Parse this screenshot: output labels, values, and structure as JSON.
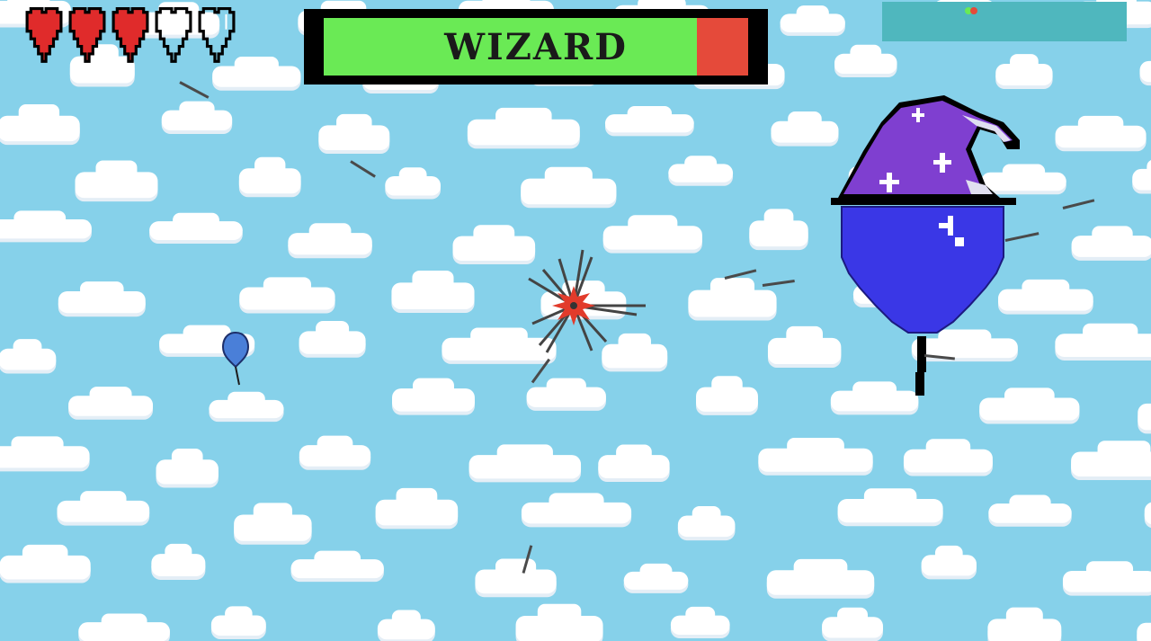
{
  "hud": {
    "hearts_total": 5,
    "hearts_filled": 3,
    "heart_color": "#e02b2b",
    "heart_icon": "pixel-heart-icon"
  },
  "boss": {
    "name": "WIZARD",
    "health_fraction": 0.88,
    "health_color": "#6aea55",
    "damage_color": "#e54a3a"
  },
  "minimap": {
    "background": "#4fb7be",
    "markers": [
      {
        "color": "#6aea55"
      },
      {
        "color": "#e54a3a"
      }
    ]
  },
  "colors": {
    "sky": "#86d1ea",
    "cloud": "#ffffff",
    "wizard_hat": "#7f3fd0",
    "wizard_balloon": "#3a37e6",
    "player_balloon": "#4a7fd8",
    "impact": "#e23b2b"
  }
}
